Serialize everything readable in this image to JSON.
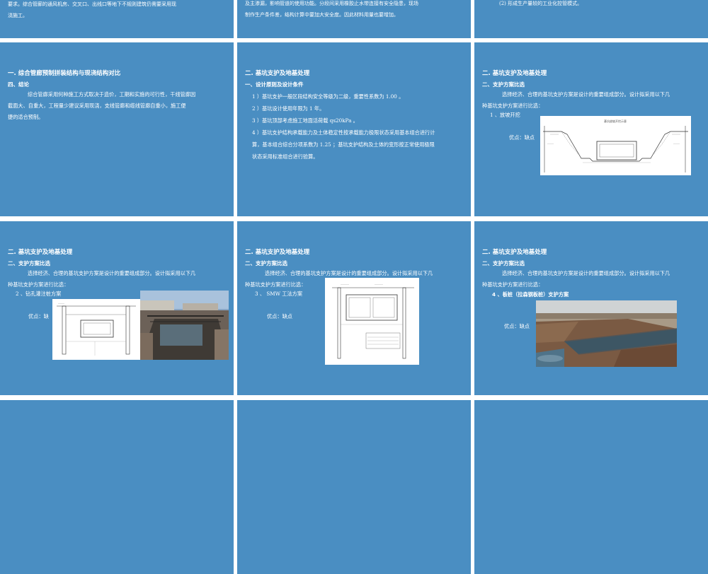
{
  "top_row": {
    "s1_line1": "要求。综合管廊的通风机房、交叉口、出线口等地下不规则建筑仍需要采用现",
    "s1_line2": "浇施工。",
    "s2_line1": "及主渗漏，影响管道的使用功能。分段间采用橡胶止水带连接有安全隐患，现场",
    "s2_line2": "制作生产条件差，结构计算中要加大安全度。因此材料用量也要增加。",
    "s3_line1": "(2) 形成生产量较的工业化控管模式。"
  },
  "slide4": {
    "title": "一. 综合管廊预制拼装结构与现浇结构对比",
    "subtitle": "四、结论",
    "paragraph_line1": "综合管廊采用何种施工方式取决于造价，工期和实施的可行性，干线管廊因",
    "paragraph_line2": "截面大、自重大，工程量少建议采用现浇，支线管廊和缆线管廊自重小，施工便",
    "paragraph_line3": "捷的适合预制。"
  },
  "slide5": {
    "title": "二. 基坑支护及地基处理",
    "subtitle": "一、设计原则及设计条件",
    "items": [
      "1 ）基坑支护一般区段结构安全等级为二级，重要性系数为 1.00 。",
      "2 ）基坑设计使用年限为 1 年。",
      "3 ）基坑顶部考虑施工地面活荷载 qs20kPa 。",
      "4 ）基坑支护结构承载能力及土体稳定性按承载能力极限状态采用基本组合进行计",
      "算，基本组合综合分项系数为 1.25 ；基坑支护结构及土体的变形按正常使用极限",
      "状态采用标准组合进行验算。"
    ]
  },
  "slide6": {
    "title": "二. 基坑支护及地基处理",
    "subtitle": "二、支护方案比选",
    "paragraph_line1": "选择经济、合理的基坑支护方案是设计的重要组成部分。设计拟采用以下几",
    "paragraph_line2": "种基坑支护方案进行比选：",
    "method": "1 、放坡开挖",
    "pros_cons": "优点：缺点",
    "figure_caption": "基坑放坡开挖示意"
  },
  "slide7": {
    "title": "二. 基坑支护及地基处理",
    "subtitle": "二、支护方案比选",
    "paragraph_line1": "选择经济、合理的基坑支护方案是设计的重要组成部分。设计拟采用以下几",
    "paragraph_line2": "种基坑支护方案进行比选：",
    "method": "2 、钻孔灌注桩方案",
    "pros_cons": "优点：缺"
  },
  "slide8": {
    "title": "二. 基坑支护及地基处理",
    "subtitle": "二、支护方案比选",
    "paragraph_line1": "选择经济、合理的基坑支护方案是设计的重要组成部分。设计拟采用以下几",
    "paragraph_line2": "种基坑支护方案进行比选：",
    "method": "3 、 SMW 工法方案",
    "pros_cons": "优点：缺点"
  },
  "slide9": {
    "title": "二. 基坑支护及地基处理",
    "subtitle": "二、支护方案比选",
    "paragraph_line1": "选择经济、合理的基坑支护方案是设计的重要组成部分。设计拟采用以下几",
    "paragraph_line2": "种基坑支护方案进行比选：",
    "method": "4 、板桩（拉森钢板桩）支护方案",
    "pros_cons": "优点：缺点"
  },
  "colors": {
    "slide_bg": "#4a8ec2",
    "page_bg": "#ffffff",
    "text": "#ffffff"
  }
}
